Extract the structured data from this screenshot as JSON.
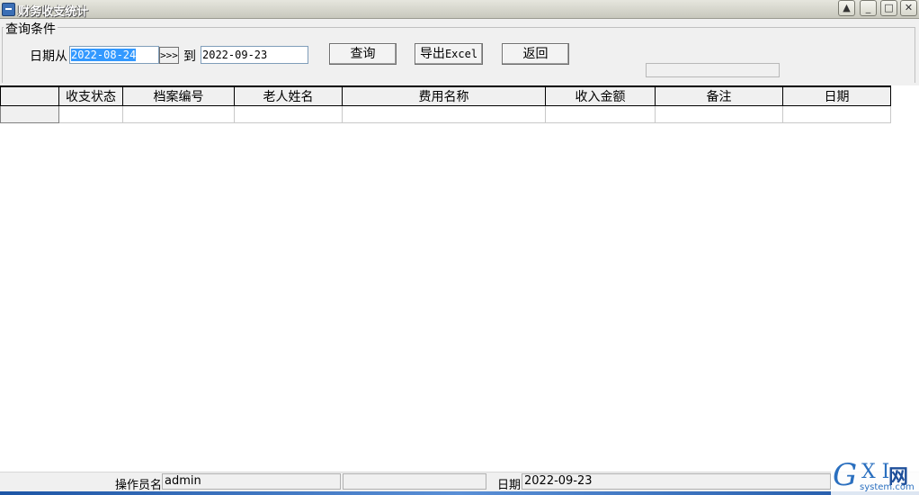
{
  "window": {
    "title": "财务收支统计",
    "buttons": {
      "up": "▲",
      "minimize": "_",
      "maximize": "□",
      "close": "✕"
    }
  },
  "query": {
    "group_label": "查询条件",
    "date_from_label": "日期从",
    "date_from_value": "2022-08-24",
    "arrow_button": ">>>",
    "to_label": "到",
    "date_to_value": "2022-09-23",
    "search_button": "查询",
    "export_button_prefix": "导出",
    "export_button_suffix": "Excel",
    "back_button": "返回"
  },
  "table": {
    "columns": [
      "收支状态",
      "档案编号",
      "老人姓名",
      "费用名称",
      "收入金额",
      "备注",
      "日期"
    ],
    "rows": [
      [
        "",
        "",
        "",
        "",
        "",
        "",
        ""
      ]
    ]
  },
  "status": {
    "operator_label": "操作员名",
    "operator_value": "admin",
    "date_label": "日期",
    "date_value": "2022-09-23"
  },
  "watermark": {
    "g": "G",
    "xi": "X I",
    "net": "网",
    "sub": "system.com"
  },
  "colors": {
    "selection": "#3399ff",
    "panel": "#f0f0f0",
    "field_border": "#7f9db9"
  }
}
